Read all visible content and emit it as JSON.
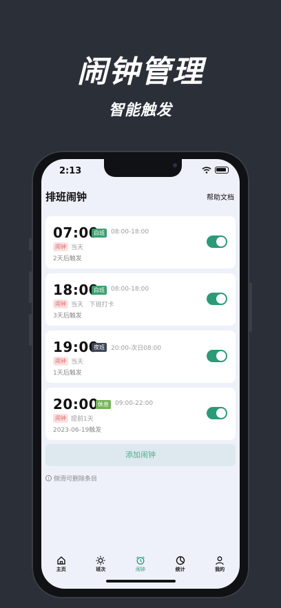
{
  "hero": {
    "title": "闹钟管理",
    "subtitle": "智能触发"
  },
  "status": {
    "time": "2:13"
  },
  "nav": {
    "title": "排班闹钟",
    "help": "帮助文档"
  },
  "alarms": [
    {
      "time": "07:00",
      "shift": "白班",
      "shift_color": "#3aa06f",
      "range": "08:00-18:00",
      "tag": "闹钟",
      "note": "当天",
      "trigger": "2天后触发",
      "enabled": true
    },
    {
      "time": "18:00",
      "shift": "白班",
      "shift_color": "#3aa06f",
      "range": "08:00-18:00",
      "tag": "闹钟",
      "note": "当天   下班打卡",
      "trigger": "3天后触发",
      "enabled": true
    },
    {
      "time": "19:00",
      "shift": "夜班",
      "shift_color": "#3d4453",
      "range": "20:00-次日08:00",
      "tag": "闹钟",
      "note": "当天",
      "trigger": "1天后触发",
      "enabled": true
    },
    {
      "time": "20:00",
      "shift": "休息",
      "shift_color": "#76b35a",
      "range": "09:00-22:00",
      "tag": "闹钟",
      "note": "提前1天",
      "trigger": "2023-06-19触发",
      "enabled": true
    }
  ],
  "add_button": "添加闹钟",
  "hint": "侧滑可删除条目",
  "tabs": [
    {
      "label": "主页",
      "icon": "home-icon"
    },
    {
      "label": "班次",
      "icon": "sun-icon"
    },
    {
      "label": "闹钟",
      "icon": "alarm-clock-icon",
      "active": true
    },
    {
      "label": "统计",
      "icon": "pie-chart-icon"
    },
    {
      "label": "我的",
      "icon": "user-icon"
    }
  ],
  "colors": {
    "accent": "#2a9a77",
    "background": "#2b3038",
    "screen": "#eef1fa"
  }
}
